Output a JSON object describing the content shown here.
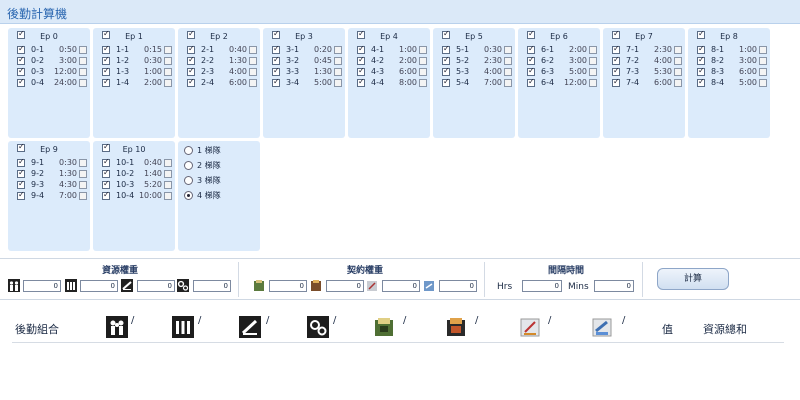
{
  "title": "後勤計算機",
  "panels": [
    {
      "label": "Ep 0",
      "rows": [
        [
          "0-1",
          "0:50"
        ],
        [
          "0-2",
          "3:00"
        ],
        [
          "0-3",
          "12:00"
        ],
        [
          "0-4",
          "24:00"
        ]
      ]
    },
    {
      "label": "Ep 1",
      "rows": [
        [
          "1-1",
          "0:15"
        ],
        [
          "1-2",
          "0:30"
        ],
        [
          "1-3",
          "1:00"
        ],
        [
          "1-4",
          "2:00"
        ]
      ]
    },
    {
      "label": "Ep 2",
      "rows": [
        [
          "2-1",
          "0:40"
        ],
        [
          "2-2",
          "1:30"
        ],
        [
          "2-3",
          "4:00"
        ],
        [
          "2-4",
          "6:00"
        ]
      ]
    },
    {
      "label": "Ep 3",
      "rows": [
        [
          "3-1",
          "0:20"
        ],
        [
          "3-2",
          "0:45"
        ],
        [
          "3-3",
          "1:30"
        ],
        [
          "3-4",
          "5:00"
        ]
      ]
    },
    {
      "label": "Ep 4",
      "rows": [
        [
          "4-1",
          "1:00"
        ],
        [
          "4-2",
          "2:00"
        ],
        [
          "4-3",
          "6:00"
        ],
        [
          "4-4",
          "8:00"
        ]
      ]
    },
    {
      "label": "Ep 5",
      "rows": [
        [
          "5-1",
          "0:30"
        ],
        [
          "5-2",
          "2:30"
        ],
        [
          "5-3",
          "4:00"
        ],
        [
          "5-4",
          "7:00"
        ]
      ]
    },
    {
      "label": "Ep 6",
      "rows": [
        [
          "6-1",
          "2:00"
        ],
        [
          "6-2",
          "3:00"
        ],
        [
          "6-3",
          "5:00"
        ],
        [
          "6-4",
          "12:00"
        ]
      ]
    },
    {
      "label": "Ep 7",
      "rows": [
        [
          "7-1",
          "2:30"
        ],
        [
          "7-2",
          "4:00"
        ],
        [
          "7-3",
          "5:30"
        ],
        [
          "7-4",
          "6:00"
        ]
      ]
    },
    {
      "label": "Ep 8",
      "rows": [
        [
          "8-1",
          "1:00"
        ],
        [
          "8-2",
          "3:00"
        ],
        [
          "8-3",
          "6:00"
        ],
        [
          "8-4",
          "5:00"
        ]
      ]
    },
    {
      "label": "Ep 9",
      "rows": [
        [
          "9-1",
          "0:30"
        ],
        [
          "9-2",
          "1:30"
        ],
        [
          "9-3",
          "4:30"
        ],
        [
          "9-4",
          "7:00"
        ]
      ]
    },
    {
      "label": "Ep 10",
      "rows": [
        [
          "10-1",
          "0:40"
        ],
        [
          "10-2",
          "1:40"
        ],
        [
          "10-3",
          "5:20"
        ],
        [
          "10-4",
          "10:00"
        ]
      ]
    }
  ],
  "teams": [
    {
      "label": "1 梯隊",
      "selected": false
    },
    {
      "label": "2 梯隊",
      "selected": false
    },
    {
      "label": "3 梯隊",
      "selected": false
    },
    {
      "label": "4 梯隊",
      "selected": true
    }
  ],
  "controls": {
    "resource_head": "資源權重",
    "contract_head": "契約權重",
    "interval_head": "間隔時間",
    "resource_values": [
      "0",
      "0",
      "0",
      "0"
    ],
    "contract_values": [
      "0",
      "0",
      "0",
      "0"
    ],
    "hrs_label": "Hrs",
    "hrs_value": "0",
    "mins_label": "Mins",
    "mins_value": "0",
    "calc_label": "計算"
  },
  "result": {
    "combo_label": "後勤組合",
    "slashes": [
      "/",
      "/",
      "/",
      "/",
      "/",
      "/",
      "/",
      "/"
    ],
    "value_label": "值",
    "total_label": "資源總和"
  },
  "colors": {
    "panel": "#dcebfb",
    "title": "#2a66b0",
    "titlebar": "#dbe9f8"
  }
}
